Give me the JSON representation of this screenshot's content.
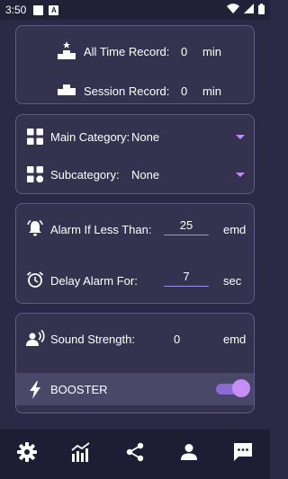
{
  "status_bar": {
    "time": "3:50",
    "notif_a_glyph": "A"
  },
  "records": {
    "all_time": {
      "label": "All Time Record:",
      "value": "0",
      "unit": "min"
    },
    "session": {
      "label": "Session Record:",
      "value": "0",
      "unit": "min"
    }
  },
  "categories": {
    "main": {
      "label": "Main Category:",
      "value": "None"
    },
    "sub": {
      "label": "Subcategory:",
      "value": "None"
    }
  },
  "alarm": {
    "threshold": {
      "label": "Alarm If Less Than:",
      "value": "25",
      "unit": "emd"
    },
    "delay": {
      "label": "Delay Alarm For:",
      "value": "7",
      "unit": "sec"
    }
  },
  "sound": {
    "strength": {
      "label": "Sound Strength:",
      "value": "0",
      "unit": "emd"
    },
    "booster": {
      "label": "BOOSTER",
      "enabled": true
    }
  },
  "colors": {
    "background": "#2b2945",
    "card": "#34324f",
    "card_border": "#5e5b88",
    "accent": "#c58ef5",
    "nav_bar": "#1f1d33"
  },
  "nav": [
    "settings-icon",
    "stats-icon",
    "share-icon",
    "profile-icon",
    "chat-icon"
  ]
}
